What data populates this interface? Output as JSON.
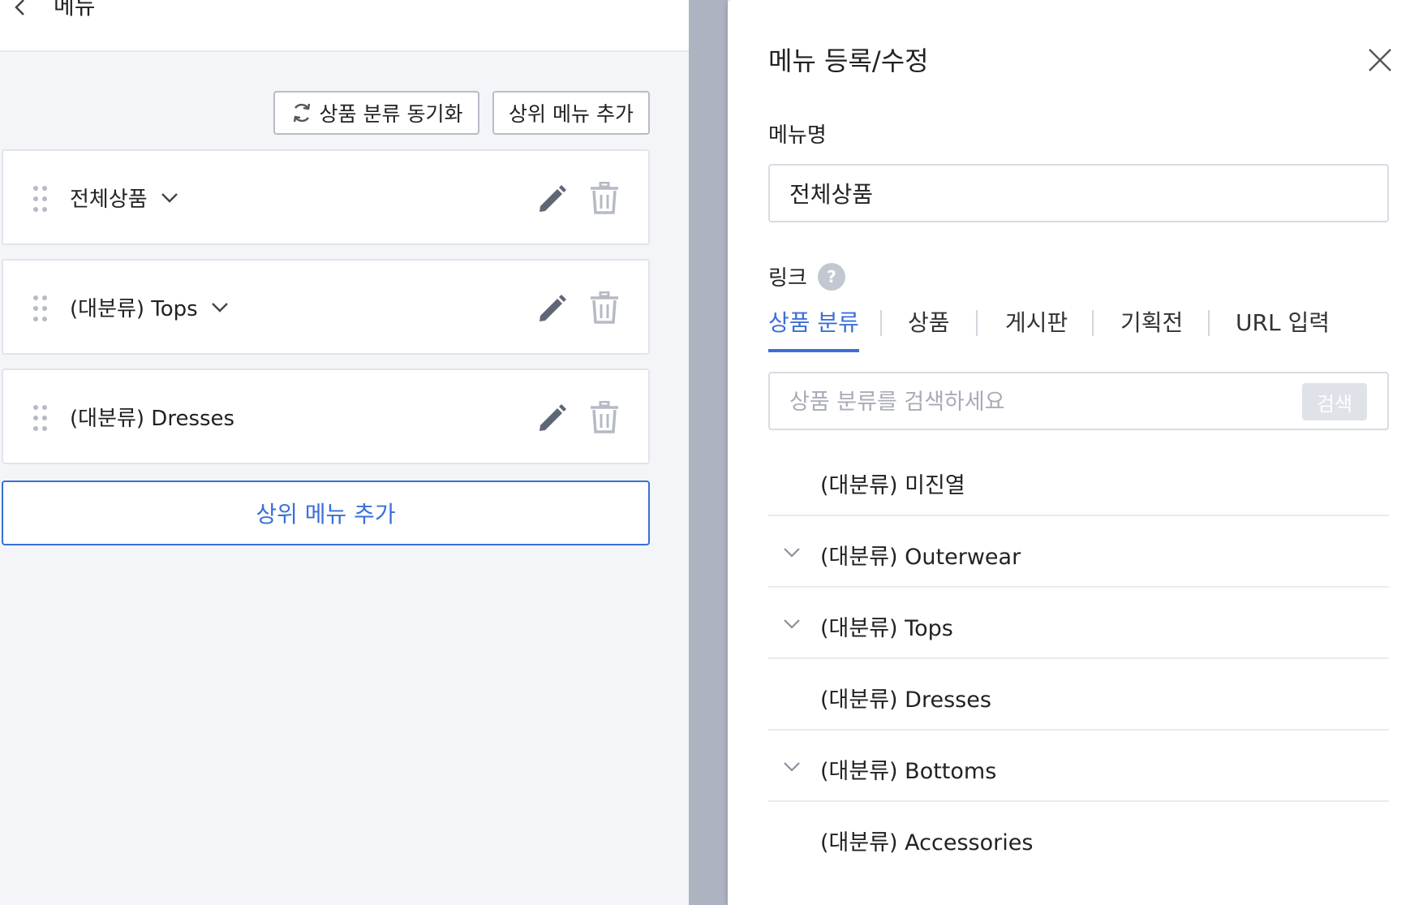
{
  "left": {
    "title": "메뉴",
    "sync_button": "상품 분류 동기화",
    "add_top_button": "상위 메뉴 추가",
    "menu_items": [
      {
        "label": "전체상품",
        "expandable": true
      },
      {
        "label": "(대분류) Tops",
        "expandable": true
      },
      {
        "label": "(대분류) Dresses",
        "expandable": false
      }
    ],
    "add_bottom_button": "상위 메뉴 추가"
  },
  "drawer": {
    "title": "메뉴 등록/수정",
    "menu_name_label": "메뉴명",
    "menu_name_value": "전체상품",
    "link_label": "링크",
    "tabs": [
      "상품 분류",
      "상품",
      "게시판",
      "기획전",
      "URL 입력"
    ],
    "active_tab": 0,
    "search_placeholder": "상품 분류를 검색하세요",
    "search_button": "검색",
    "categories": [
      {
        "label": "(대분류) 미진열",
        "expandable": false
      },
      {
        "label": "(대분류) Outerwear",
        "expandable": true
      },
      {
        "label": "(대분류) Tops",
        "expandable": true
      },
      {
        "label": "(대분류) Dresses",
        "expandable": false
      },
      {
        "label": "(대분류) Bottoms",
        "expandable": true
      },
      {
        "label": "(대분류) Accessories",
        "expandable": false
      }
    ]
  },
  "colors": {
    "accent": "#3a6fd8",
    "icon_gray": "#5f6674",
    "overlay": "#aeb3c2",
    "background": "#f3f5f9"
  },
  "icons": {
    "back": "chevron-left-icon",
    "sync": "sync-icon",
    "drag": "drag-handle-icon",
    "expand": "chevron-down-icon",
    "edit": "pencil-icon",
    "delete": "trash-icon",
    "close": "close-icon",
    "help": "question-icon"
  }
}
